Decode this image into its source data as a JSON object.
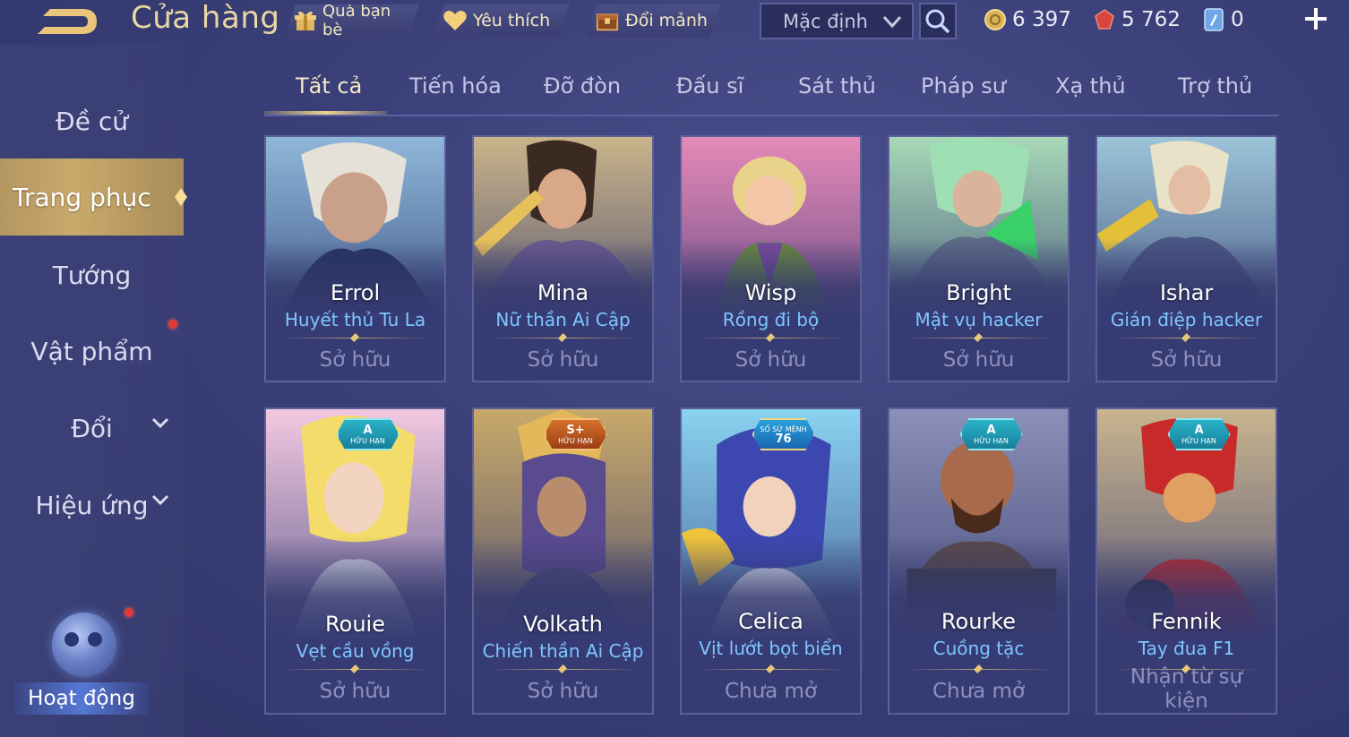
{
  "header": {
    "title": "Cửa hàng",
    "buttons": [
      {
        "label": "Quà bạn bè",
        "icon": "gift-icon"
      },
      {
        "label": "Yêu thích",
        "icon": "heart-icon"
      },
      {
        "label": "Đổi mảnh",
        "icon": "chest-icon"
      }
    ],
    "sort_value": "Mặc định",
    "currencies": [
      {
        "icon": "gold-coin-icon",
        "value": "6 397"
      },
      {
        "icon": "red-gem-icon",
        "value": "5 762"
      },
      {
        "icon": "voucher-icon",
        "value": "0"
      }
    ],
    "colors": {
      "title": "#e9d7a4",
      "accent_gold": "#c9aa6c",
      "skin_name": "#7fc6ff"
    }
  },
  "sidebar": {
    "items": [
      {
        "label": "Đề cử"
      },
      {
        "label": "Trang phục",
        "active": true
      },
      {
        "label": "Tướng"
      },
      {
        "label": "Vật phẩm",
        "notification": true
      },
      {
        "label": "Đổi",
        "expandable": true
      },
      {
        "label": "Hiệu ứng",
        "expandable": true
      }
    ],
    "activity_label": "Hoạt động"
  },
  "tabs": [
    "Tất cả",
    "Tiến hóa",
    "Đỡ đòn",
    "Đấu sĩ",
    "Sát thủ",
    "Pháp sư",
    "Xạ thủ",
    "Trợ thủ"
  ],
  "active_tab": "Tất cả",
  "cards": [
    {
      "hero": "Errol",
      "skin": "Huyết thủ Tu La",
      "status": "Sở hữu",
      "badge": null
    },
    {
      "hero": "Mina",
      "skin": "Nữ thần Ai Cập",
      "status": "Sở hữu",
      "badge": null
    },
    {
      "hero": "Wisp",
      "skin": "Rồng đi bộ",
      "status": "Sở hữu",
      "badge": null
    },
    {
      "hero": "Bright",
      "skin": "Mật vụ hacker",
      "status": "Sở hữu",
      "badge": null
    },
    {
      "hero": "Ishar",
      "skin": "Gián điệp hacker",
      "status": "Sở hữu",
      "badge": null
    },
    {
      "hero": "Rouie",
      "skin": "Vẹt cầu vồng",
      "status": "Sở hữu",
      "badge": {
        "tier": "A",
        "sub": "HỮU HẠN"
      }
    },
    {
      "hero": "Volkath",
      "skin": "Chiến thần Ai Cập",
      "status": "Sở hữu",
      "badge": {
        "tier": "S+",
        "sub": "HỮU HẠN"
      }
    },
    {
      "hero": "Celica",
      "skin": "Vịt lướt bọt biển",
      "status": "Chưa mở",
      "badge": {
        "tier": "76",
        "sub": "SỐ SỨ MỆNH"
      }
    },
    {
      "hero": "Rourke",
      "skin": "Cuồng tặc",
      "status": "Chưa mở",
      "badge": {
        "tier": "A",
        "sub": "HỮU HẠN"
      }
    },
    {
      "hero": "Fennik",
      "skin": "Tay đua F1",
      "status": "Nhận từ sự kiện",
      "badge": {
        "tier": "A",
        "sub": "HỮU HẠN"
      }
    }
  ]
}
